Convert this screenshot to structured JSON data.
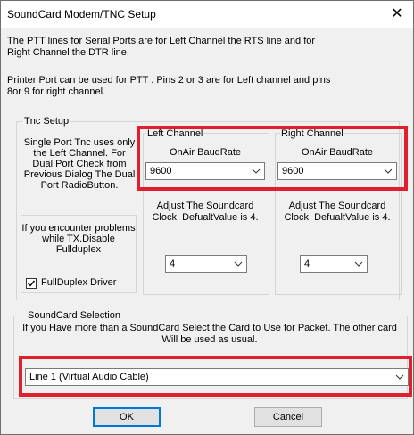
{
  "window": {
    "title": "SoundCard Modem/TNC Setup"
  },
  "intro": {
    "ptt_line1": "The PTT lines for Serial Ports are for Left Channel the RTS line and for",
    "ptt_line2": "Right Channel the DTR line.",
    "printer_line1": "Printer Port can be used for PTT . Pins 2 or 3 are for Left channel and pins",
    "printer_line2": "8or 9 for right channel."
  },
  "tnc_setup": {
    "legend": "Tnc Setup",
    "single_port_lines": [
      "Single Port Tnc uses only",
      "the Left Channel. For",
      "Dual Port Check from",
      "Previous Dialog The Dual",
      "Port RadioButton."
    ],
    "problems_lines": [
      "If you encounter problems",
      "while TX.Disable",
      "Fullduplex"
    ],
    "fullduplex_label": "FullDuplex Driver",
    "fullduplex_checked": true
  },
  "left_channel": {
    "legend": "Left Channel",
    "baud_label": "OnAir BaudRate",
    "baud_value": "9600",
    "clock_lines": [
      "Adjust The Soundcard",
      "Clock. DefualtValue is 4."
    ],
    "clock_value": "4"
  },
  "right_channel": {
    "legend": "Right Channel",
    "baud_label": "OnAir BaudRate",
    "baud_value": "9600",
    "clock_lines": [
      "Adjust The Soundcard",
      "Clock. DefualtValue is 4."
    ],
    "clock_value": "4"
  },
  "soundcard": {
    "legend": "SoundCard Selection",
    "desc_line1": "If you Have more than a SoundCard Select the Card to Use for Packet. The other card",
    "desc_line2": "Will be used as usual.",
    "selected": "Line 1 (Virtual Audio Cable)"
  },
  "buttons": {
    "ok": "OK",
    "cancel": "Cancel"
  },
  "colors": {
    "highlight": "#e0202e",
    "focus": "#0078d7"
  }
}
